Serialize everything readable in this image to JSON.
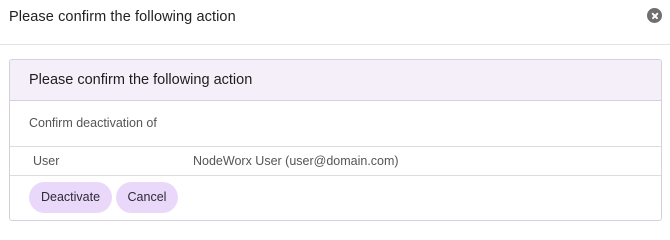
{
  "dialog": {
    "title": "Please confirm the following action",
    "close_icon": "close-circle-icon"
  },
  "panel": {
    "heading": "Please confirm the following action",
    "intro": "Confirm deactivation of",
    "rows": [
      {
        "label": "User",
        "value": "NodeWorx User (user@domain.com)"
      }
    ]
  },
  "actions": {
    "deactivate_label": "Deactivate",
    "cancel_label": "Cancel"
  },
  "colors": {
    "panel_heading_bg": "#f4eff8",
    "button_bg": "#ead8fb",
    "close_icon": "#6f6f6f"
  }
}
